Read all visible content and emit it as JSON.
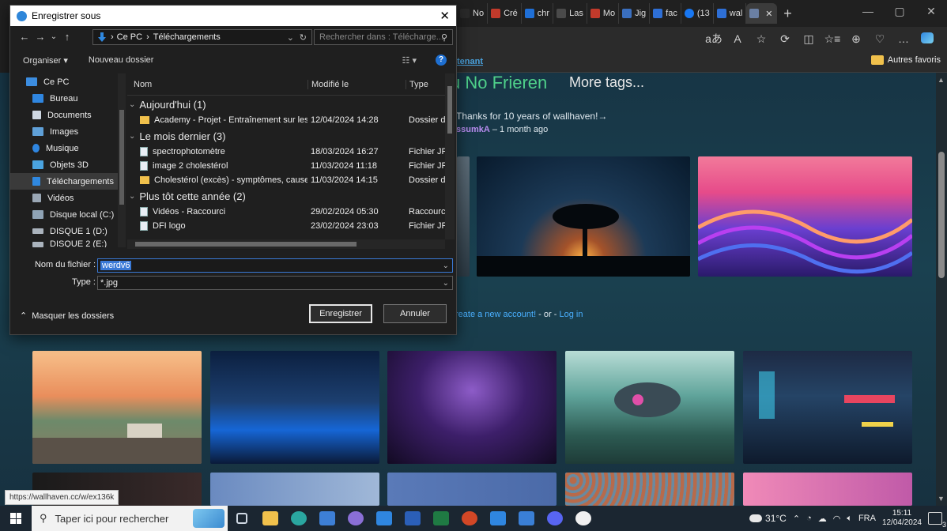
{
  "browser": {
    "tabs": [
      {
        "label": "No",
        "color": "#2a2a2a"
      },
      {
        "label": "Cré",
        "color": "#c23a2b"
      },
      {
        "label": "chr",
        "color": "#1f6fd6"
      },
      {
        "label": "Las",
        "color": "#4a4a4a"
      },
      {
        "label": "Mo",
        "color": "#c23a2b"
      },
      {
        "label": "Jig",
        "color": "#3a6fbf"
      },
      {
        "label": "fac",
        "color": "#2e6fd6"
      },
      {
        "label": "(13",
        "color": "#1877f2"
      },
      {
        "label": "wal",
        "color": "#2e6fd6"
      },
      {
        "label": "",
        "color": "#6a7fa3"
      }
    ],
    "new_tab": "+",
    "win_minimize": "—",
    "win_restore": "▢",
    "win_close": "✕",
    "toolbar_icons": [
      "aあ",
      "A",
      "☆",
      "⟳",
      "◫",
      "☆≡",
      "⊕",
      "♡",
      "…"
    ],
    "favbar_link": "tenant",
    "other_favorites": "Autres favoris"
  },
  "page": {
    "tag_title": "u No Frieren",
    "more_tags": "More tags...",
    "announcement": "Thanks for 10 years of wallhaven!→",
    "announcement_user": "ssumkA",
    "announcement_time": " – 1 month ago",
    "signup_prefix": "reate a new account!",
    "signup_or": " - or - ",
    "signup_login": "Log in",
    "status_url": "https://wallhaven.cc/w/ex136k"
  },
  "dialog": {
    "title": "Enregistrer sous",
    "close": "✕",
    "nav_back": "←",
    "nav_forward": "→",
    "nav_recent": "⌄",
    "nav_up": "↑",
    "breadcrumb_root": "Ce PC",
    "breadcrumb_sep": "›",
    "breadcrumb_current": "Téléchargements",
    "search_placeholder": "Rechercher dans : Télécharge...",
    "organize": "Organiser ▾",
    "new_folder": "Nouveau dossier",
    "help": "?",
    "nav_items": [
      {
        "label": "Ce PC",
        "color": "#3c8de0",
        "selected": false
      },
      {
        "label": "Bureau",
        "color": "#2f86e0",
        "selected": false
      },
      {
        "label": "Documents",
        "color": "#cfd8e3",
        "selected": false
      },
      {
        "label": "Images",
        "color": "#5fa0d8",
        "selected": false
      },
      {
        "label": "Musique",
        "color": "#2f86e0",
        "selected": false
      },
      {
        "label": "Objets 3D",
        "color": "#4aa3df",
        "selected": false
      },
      {
        "label": "Téléchargements",
        "color": "#2f88e0",
        "selected": true
      },
      {
        "label": "Vidéos",
        "color": "#9aa7b5",
        "selected": false
      },
      {
        "label": "Disque local (C:)",
        "color": "#8fa3b5",
        "selected": false
      },
      {
        "label": "DISQUE 1 (D:)",
        "color": "#aab3bd",
        "selected": false
      },
      {
        "label": "DISQUE 2 (E:)",
        "color": "#aab3bd",
        "selected": false
      }
    ],
    "columns": {
      "name": "Nom",
      "date": "Modifié le",
      "type": "Type"
    },
    "groups": [
      {
        "label": "Aujourd'hui (1)",
        "files": [
          {
            "name": "Academy - Projet - Entraînement sur les ...",
            "date": "12/04/2024 14:28",
            "type": "Dossier de",
            "icon": "folder"
          }
        ]
      },
      {
        "label": "Le mois dernier (3)",
        "files": [
          {
            "name": "spectrophotomètre",
            "date": "18/03/2024 16:27",
            "type": "Fichier JP",
            "icon": "image"
          },
          {
            "name": "image 2 cholestérol",
            "date": "11/03/2024 11:18",
            "type": "Fichier JP",
            "icon": "image"
          },
          {
            "name": "Cholestérol (excès) - symptômes, causes,...",
            "date": "11/03/2024 14:15",
            "type": "Dossier de",
            "icon": "folder"
          }
        ]
      },
      {
        "label": "Plus tôt cette année (2)",
        "files": [
          {
            "name": "Vidéos - Raccourci",
            "date": "29/02/2024 05:30",
            "type": "Raccourci",
            "icon": "shortcut"
          },
          {
            "name": "DFI logo",
            "date": "23/02/2024 23:03",
            "type": "Fichier JP",
            "icon": "image"
          }
        ]
      }
    ],
    "filename_label": "Nom du fichier :",
    "filename_value": "werdv6",
    "type_label": "Type :",
    "type_value": "*.jpg",
    "hide_folders": "Masquer les dossiers",
    "save_button": "Enregistrer",
    "cancel_button": "Annuler"
  },
  "taskbar": {
    "search_placeholder": "Taper ici pour rechercher",
    "apps": [
      {
        "name": "task-view",
        "color": "#cfd8e3"
      },
      {
        "name": "file-explorer",
        "color": "#f1c14c"
      },
      {
        "name": "edge",
        "color": "#2aa6a0"
      },
      {
        "name": "app-blue",
        "color": "#3d7fd6"
      },
      {
        "name": "paint",
        "color": "#8a6fd6"
      },
      {
        "name": "calendar",
        "color": "#2f86e0"
      },
      {
        "name": "word",
        "color": "#2b5fb8"
      },
      {
        "name": "excel",
        "color": "#1f7a43"
      },
      {
        "name": "powerpoint",
        "color": "#d24726"
      },
      {
        "name": "mail",
        "color": "#2f86e0"
      },
      {
        "name": "store",
        "color": "#3a7fd6"
      },
      {
        "name": "discord",
        "color": "#5865f2"
      },
      {
        "name": "github",
        "color": "#f0f0f0"
      }
    ],
    "weather": "31°C",
    "language": "FRA",
    "time": "15:11",
    "date": "12/04/2024",
    "notifications": "3"
  }
}
